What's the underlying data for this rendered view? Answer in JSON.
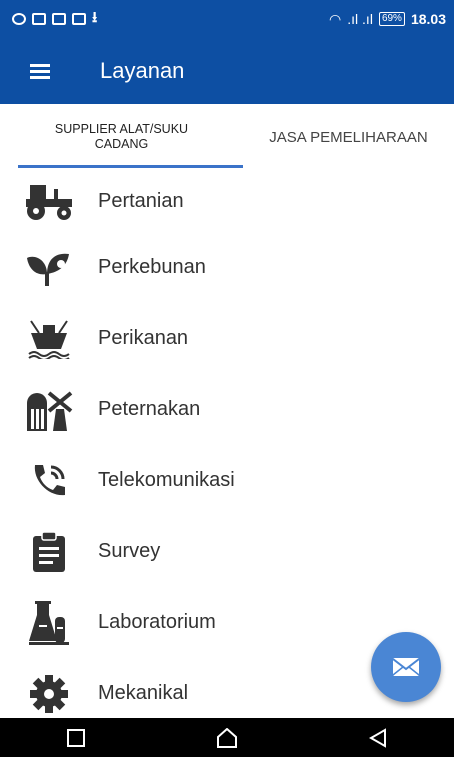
{
  "status_bar": {
    "battery": "69%",
    "time": "18.03",
    "signal": ".ıl .ıl"
  },
  "app_bar": {
    "title": "Layanan",
    "menu_icon": "hamburger-icon"
  },
  "tabs": [
    {
      "label": "SUPPLIER ALAT/SUKU CADANG",
      "selected": true
    },
    {
      "label": "JASA PEMELIHARAAN",
      "selected": false
    }
  ],
  "services": [
    {
      "label": "Pertanian",
      "icon": "tractor-icon"
    },
    {
      "label": "Perkebunan",
      "icon": "leaf-sprout-icon"
    },
    {
      "label": "Perikanan",
      "icon": "fishing-boat-icon"
    },
    {
      "label": "Peternakan",
      "icon": "barn-windmill-icon"
    },
    {
      "label": "Telekomunikasi",
      "icon": "phone-call-icon"
    },
    {
      "label": "Survey",
      "icon": "clipboard-icon"
    },
    {
      "label": "Laboratorium",
      "icon": "lab-flask-icon"
    },
    {
      "label": "Mekanikal",
      "icon": "gear-icon"
    }
  ],
  "fab": {
    "icon": "envelope-icon"
  },
  "nav_bar": {
    "icons": [
      "recent-apps-icon",
      "home-icon",
      "back-icon"
    ]
  },
  "colors": {
    "primary": "#0d4fa3",
    "accent": "#4a86d4",
    "tab_indicator": "#3b73c9"
  }
}
